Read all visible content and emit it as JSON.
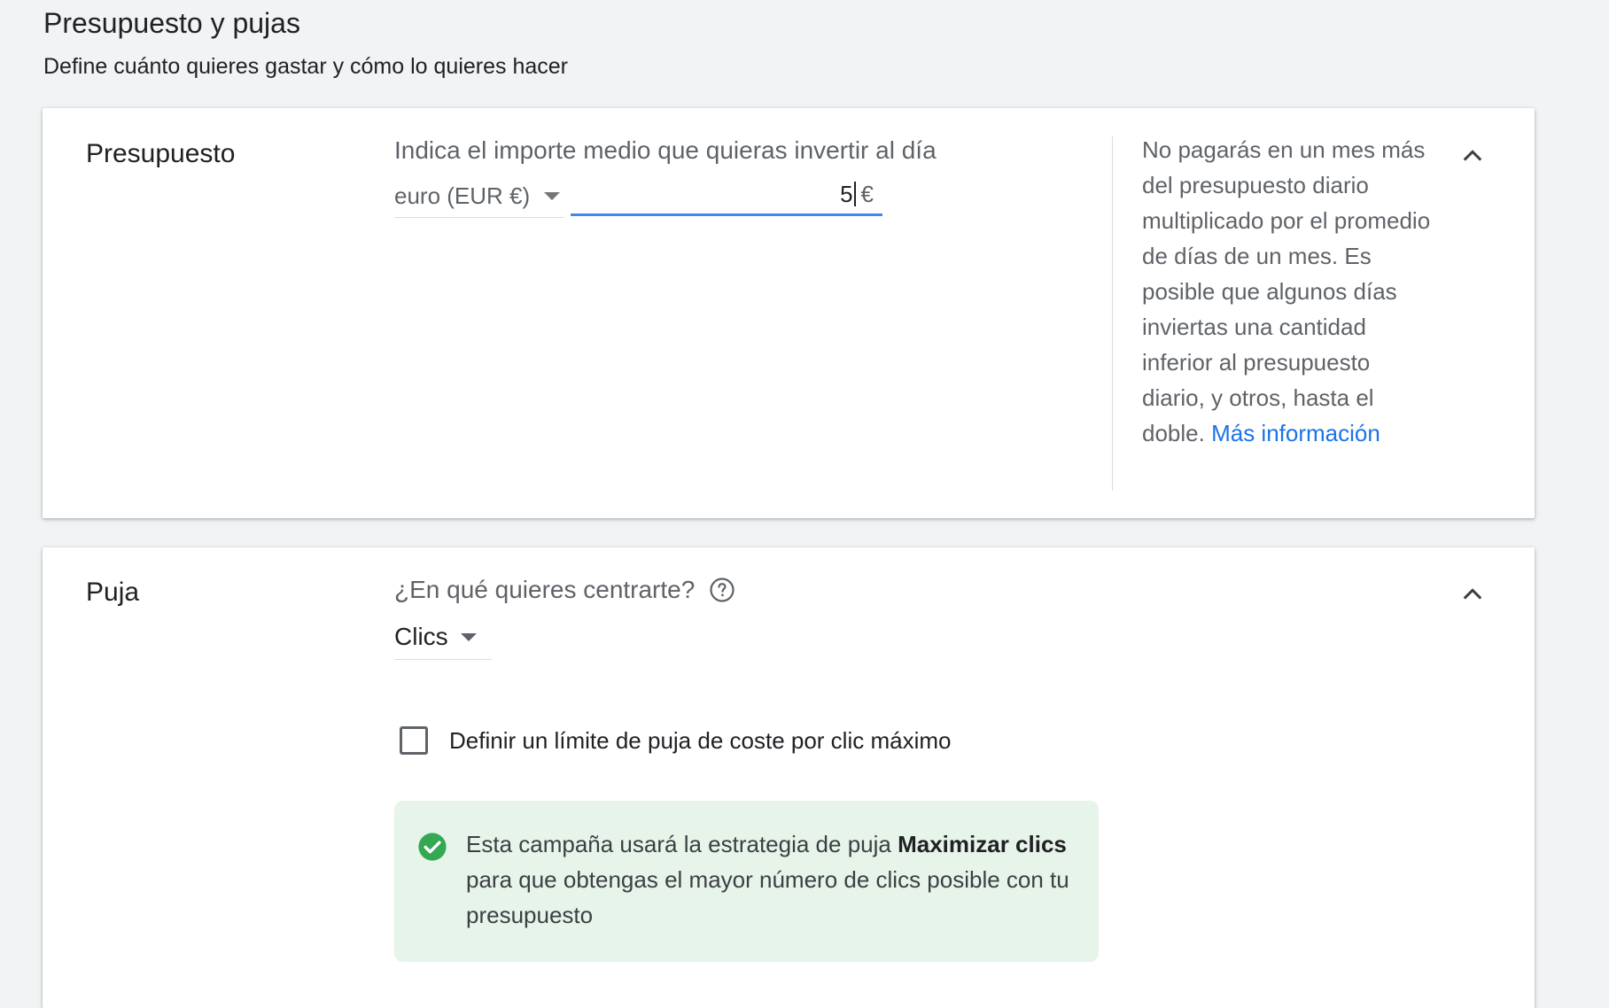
{
  "header": {
    "title": "Presupuesto y pujas",
    "subtitle": "Define cuánto quieres gastar y cómo lo quieres hacer"
  },
  "budget": {
    "section_title": "Presupuesto",
    "field_label": "Indica el importe medio que quieras invertir al día",
    "currency_value": "euro (EUR €)",
    "amount_value": "5",
    "amount_symbol": "€",
    "help_text": "No pagarás en un mes más del presupuesto diario multiplicado por el promedio de días de un mes. Es posible que algunos días inviertas una cantidad inferior al presupuesto diario, y otros, hasta el doble.",
    "help_link": "Más información",
    "collapse_icon": "chevron-up-icon"
  },
  "bid": {
    "section_title": "Puja",
    "question_label": "¿En qué quieres centrarte?",
    "question_icon": "help-circle-icon",
    "focus_value": "Clics",
    "checkbox_label": "Definir un límite de puja de coste por clic máximo",
    "checkbox_checked": false,
    "info_prefix": "Esta campaña usará la estrategia de puja",
    "info_strategy": "Maximizar clics",
    "info_suffix": "para que obtengas el mayor número de clics posible con tu presupuesto",
    "info_icon": "check-circle-icon",
    "collapse_icon": "chevron-up-icon"
  },
  "colors": {
    "accent": "#4285f4",
    "link": "#1a73e8",
    "success": "#34a853",
    "success_bg": "#e6f4ea",
    "page_bg": "#f1f3f4"
  }
}
